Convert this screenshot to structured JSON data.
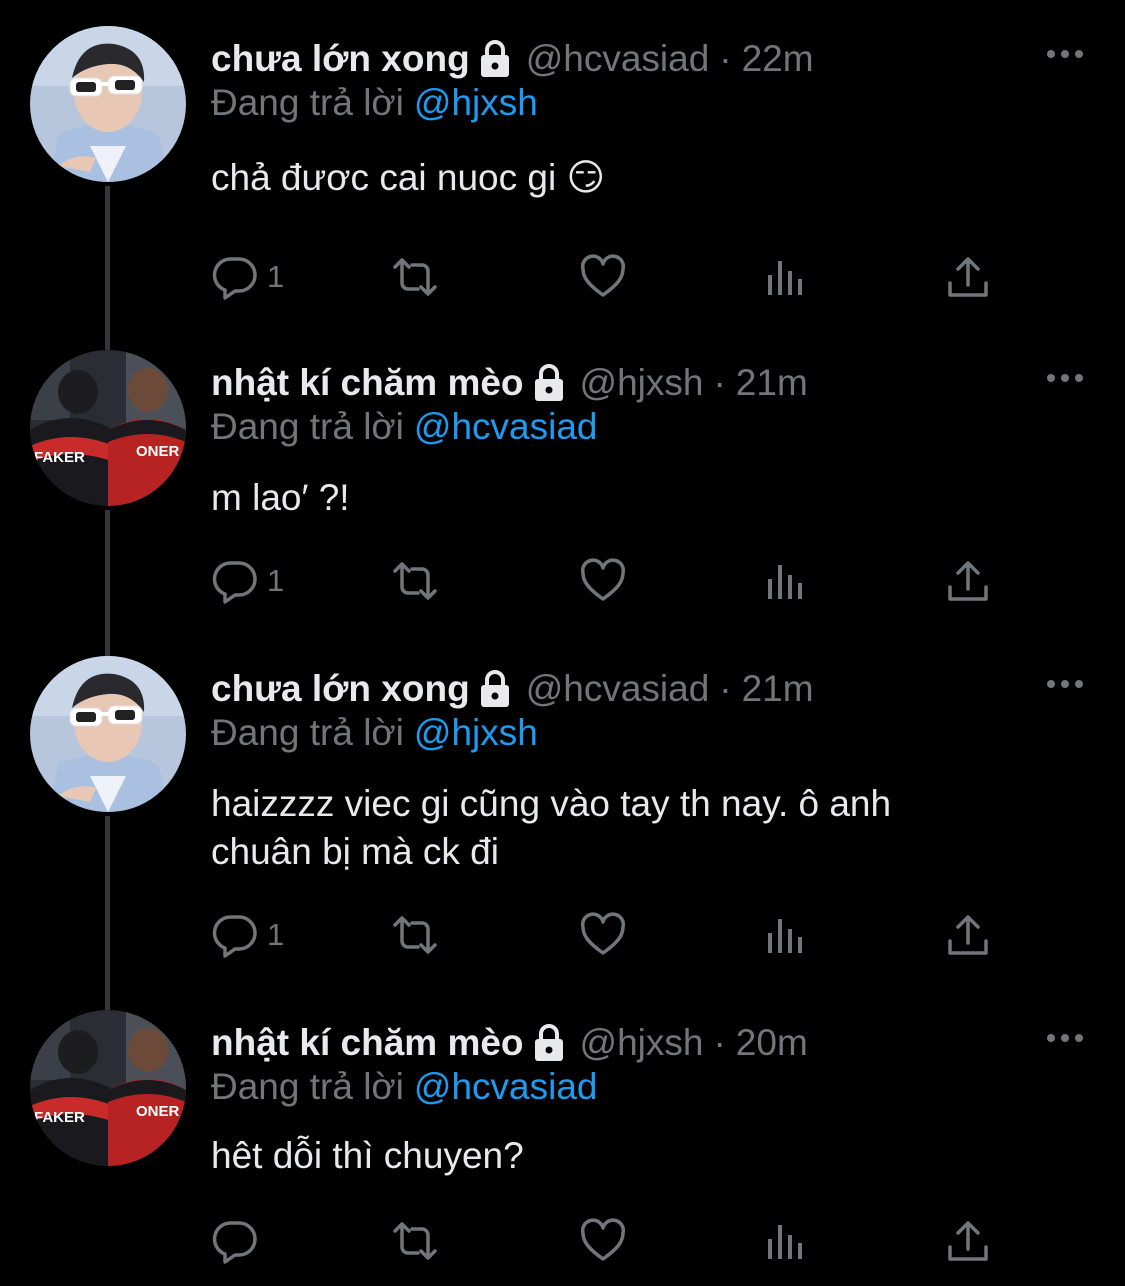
{
  "tweets": [
    {
      "display_name": "chưa lớn xong",
      "handle": "@hcvasiad",
      "separator": "·",
      "time": "22m",
      "reply_prefix": "Đang trả lời",
      "reply_to": "@hjxsh",
      "text": "chả đươc cai nuoc gi 😏",
      "reply_count": "1",
      "avatar": "person-white-sunglasses"
    },
    {
      "display_name": "nhật kí chăm mèo",
      "handle": "@hjxsh",
      "separator": "·",
      "time": "21m",
      "reply_prefix": "Đang trả lời",
      "reply_to": "@hcvasiad",
      "text": "m lao′ ?!",
      "reply_count": "1",
      "avatar": "two-players-jerseys",
      "jersey_left": "FAKER",
      "jersey_right": "ONER"
    },
    {
      "display_name": "chưa lớn xong",
      "handle": "@hcvasiad",
      "separator": "·",
      "time": "21m",
      "reply_prefix": "Đang trả lời",
      "reply_to": "@hjxsh",
      "text": "haizzzz viec gi cũng vào tay th nay. ô anh chuân bị mà ck đi",
      "reply_count": "1",
      "avatar": "person-white-sunglasses"
    },
    {
      "display_name": "nhật kí chăm mèo",
      "handle": "@hjxsh",
      "separator": "·",
      "time": "20m",
      "reply_prefix": "Đang trả lời",
      "reply_to": "@hcvasiad",
      "text": "hêt dỗi thì chuyen?",
      "reply_count": "",
      "avatar": "two-players-jerseys",
      "jersey_left": "FAKER",
      "jersey_right": "ONER"
    }
  ],
  "icons": {
    "reply": "reply-icon",
    "retweet": "retweet-icon",
    "like": "heart-icon",
    "views": "views-icon",
    "share": "share-icon",
    "more": "more-icon",
    "lock": "lock-icon"
  },
  "colors": {
    "background": "#000000",
    "primary_text": "#e7e9ea",
    "secondary_text": "#71767b",
    "mention": "#1d9bf0",
    "thread_line": "#333639"
  }
}
